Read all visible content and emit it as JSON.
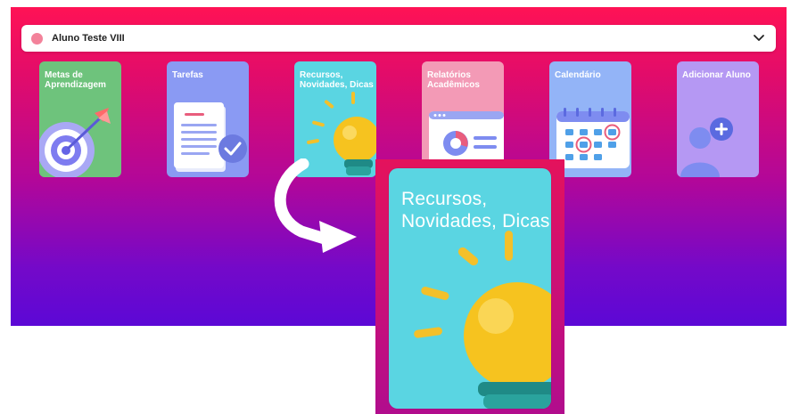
{
  "student_selector": {
    "selected": "Aluno Teste VIII",
    "avatar_color": "#f3829a",
    "dropdown_icon": "chevron-down-icon"
  },
  "cards": [
    {
      "id": "metas",
      "title": "Metas de Aprendizagem",
      "color": "#6ec37c",
      "icon": "target-arrow-icon"
    },
    {
      "id": "tarefas",
      "title": "Tarefas",
      "color": "#8a9af3",
      "icon": "checklist-document-icon"
    },
    {
      "id": "recursos",
      "title": "Recursos, Novidades, Dicas",
      "color": "#5ad5e2",
      "icon": "lightbulb-icon"
    },
    {
      "id": "relatorios",
      "title": "Relatórios Acadêmicos",
      "color": "#f39ab6",
      "icon": "report-chart-icon"
    },
    {
      "id": "calendario",
      "title": "Calendário",
      "color": "#93b4f7",
      "icon": "calendar-icon"
    },
    {
      "id": "adicionar",
      "title": "Adicionar Aluno",
      "color": "#b598f3",
      "icon": "add-user-icon"
    }
  ],
  "zoom_callout": {
    "title": "Recursos, Novidades, Dicas",
    "icon": "lightbulb-icon",
    "pointer_icon": "curved-arrow-icon"
  },
  "colors": {
    "gradient_top": "#ff1255",
    "gradient_bottom": "#5c08d6"
  }
}
